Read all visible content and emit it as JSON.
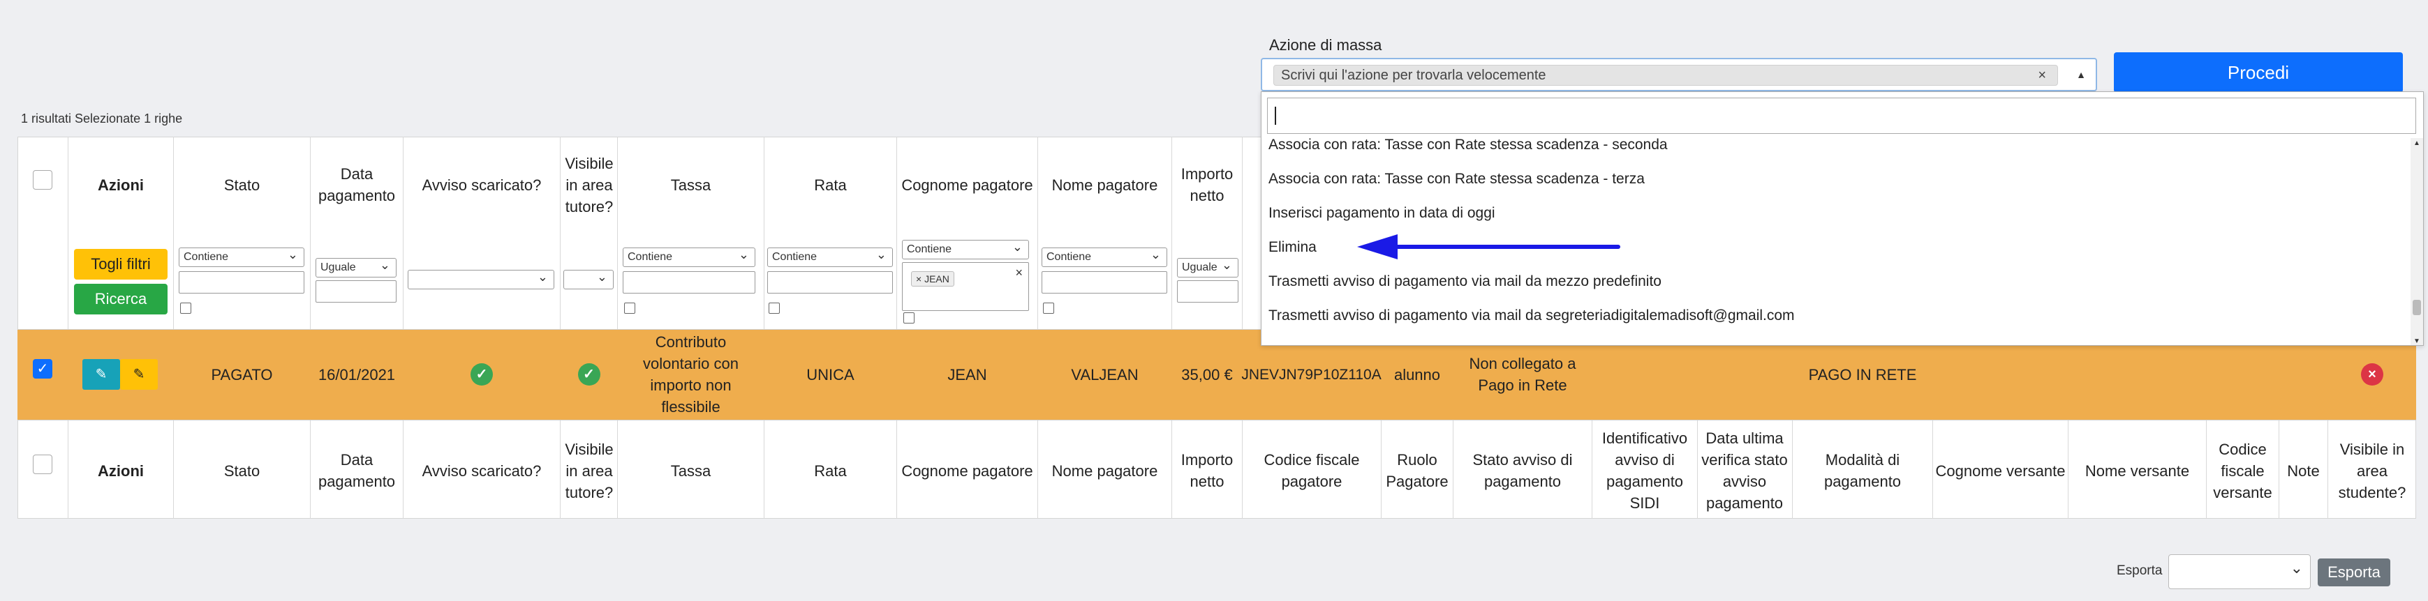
{
  "mass_action": {
    "label": "Azione di massa",
    "selected": "Scrivi qui l'azione per trovarla velocemente",
    "clear_icon": "×",
    "proceed_label": "Procedi",
    "options": [
      "Associa con rata: Tasse con Rate stessa scadenza - seconda",
      "Associa con rata: Tasse con Rate stessa scadenza - terza",
      "Inserisci pagamento in data di oggi",
      "Elimina",
      "Trasmetti avviso di pagamento via mail da mezzo predefinito",
      "Trasmetti avviso di pagamento via mail da segreteriadigitalemadisoft@gmail.com"
    ]
  },
  "results_info": "1 risultati   Selezionate 1 righe",
  "headers": {
    "azioni": "Azioni",
    "stato": "Stato",
    "data_pagamento": "Data pagamento",
    "avviso_scaricato": "Avviso scaricato?",
    "visibile_tutore": "Visibile in area tutore?",
    "tassa": "Tassa",
    "rata": "Rata",
    "cognome_pagatore": "Cognome pagatore",
    "nome_pagatore": "Nome pagatore",
    "importo_netto": "Importo netto",
    "codice_fiscale_pagatore": "Codice fiscale pagatore",
    "ruolo_pagatore": "Ruolo Pagatore",
    "stato_avviso": "Stato avviso di pagamento",
    "id_avviso_sidi": "Identificativo avviso di pagamento SIDI",
    "data_verifica": "Data ultima verifica stato avviso pagamento",
    "modalita": "Modalità di pagamento",
    "cognome_versante": "Cognome versante",
    "nome_versante": "Nome versante",
    "cf_versante": "Codice fiscale versante",
    "note": "Note",
    "visibile_studente": "Visibile in area studente?"
  },
  "filters": {
    "togli_filtri": "Togli filtri",
    "ricerca": "Ricerca",
    "contiene": "Contiene",
    "uguale": "Uguale",
    "cognome_tag": "JEAN",
    "tag_x": "×"
  },
  "row": {
    "stato": "PAGATO",
    "data": "16/01/2021",
    "tassa": "Contributo volontario con importo non flessibile",
    "rata": "UNICA",
    "cognome": "JEAN",
    "nome": "VALJEAN",
    "importo": "35,00 €",
    "codice_fiscale": "JNEVJN79P10Z110A",
    "ruolo": "alunno",
    "stato_avviso": "Non collegato a Pago in Rete",
    "modalita": "PAGO IN RETE"
  },
  "export": {
    "label": "Esporta",
    "button": "Esporta"
  },
  "colors": {
    "selected_row": "#efad4d",
    "proceed": "#0d6efd",
    "arrow": "#1a1ae6"
  }
}
